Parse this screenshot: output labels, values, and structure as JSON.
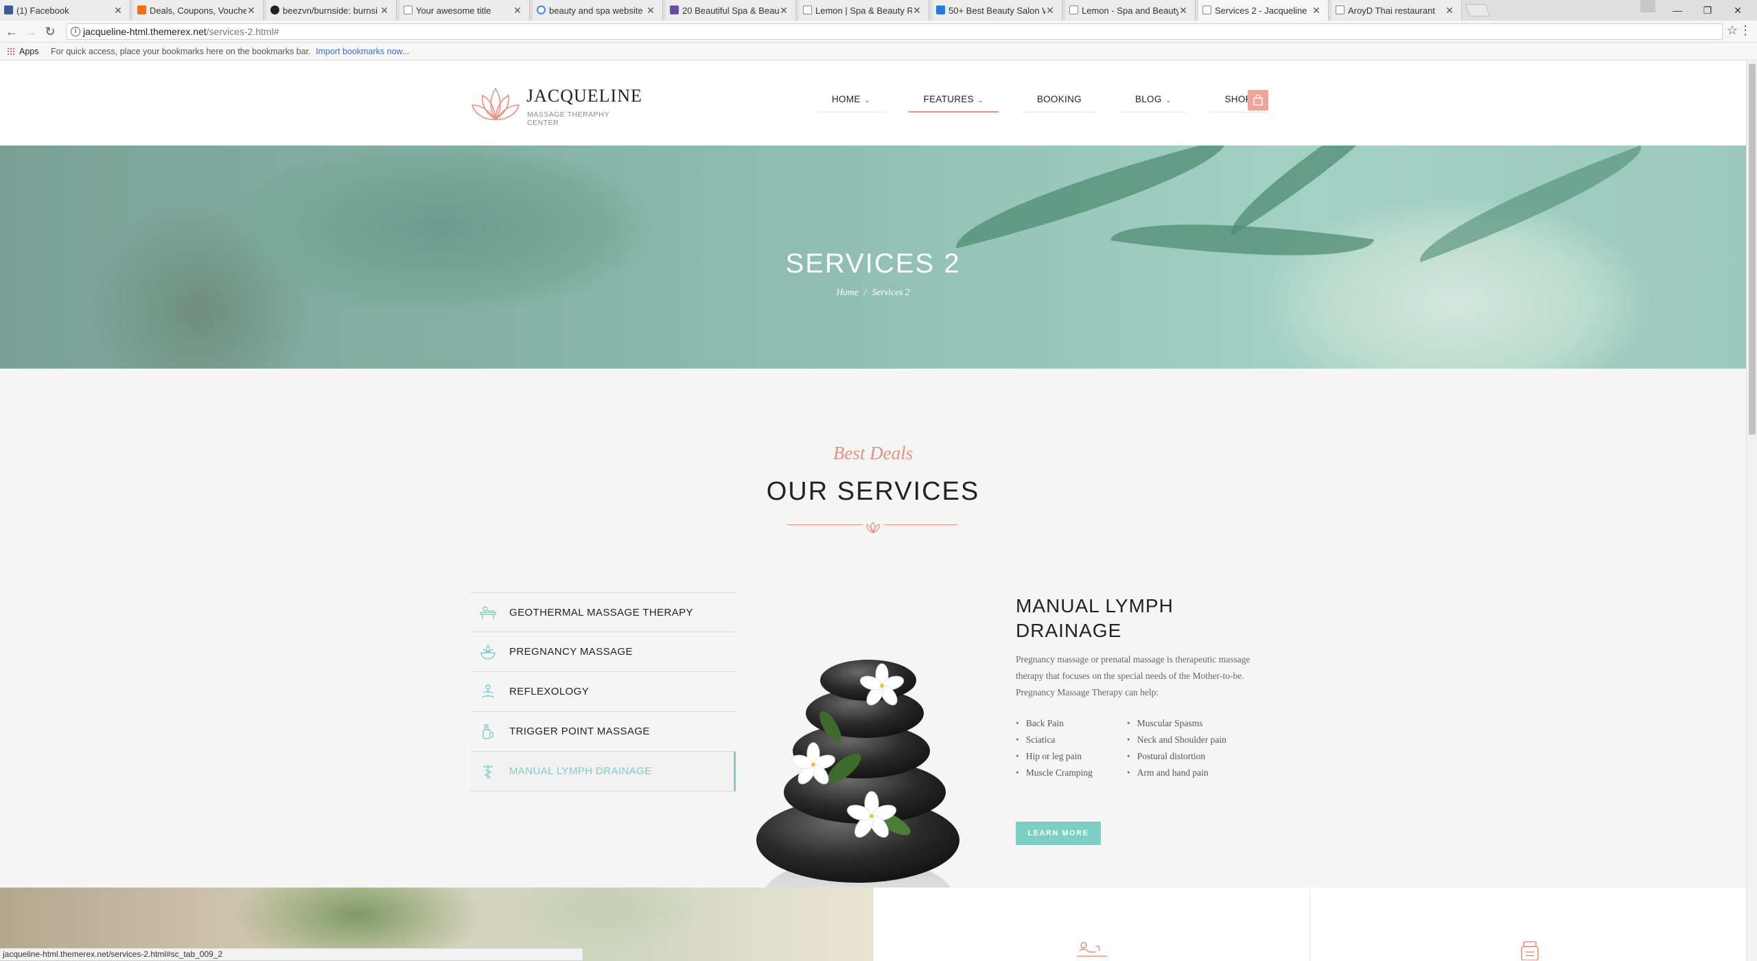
{
  "browser": {
    "tabs": [
      {
        "title": "(1) Facebook",
        "active": false
      },
      {
        "title": "Deals, Coupons, Voucher",
        "active": false
      },
      {
        "title": "beezvn/burnside: burnsi",
        "active": false
      },
      {
        "title": "Your awesome title",
        "active": false
      },
      {
        "title": "beauty and spa website",
        "active": false
      },
      {
        "title": "20 Beautiful Spa & Beau",
        "active": false
      },
      {
        "title": "Lemon | Spa & Beauty R",
        "active": false
      },
      {
        "title": "50+ Best Beauty Salon W",
        "active": false
      },
      {
        "title": "Lemon - Spa and Beauty",
        "active": false
      },
      {
        "title": "Services 2 - Jacqueline",
        "active": true
      },
      {
        "title": "AroyD Thai restaurant",
        "active": false
      }
    ],
    "url_host": "jacqueline-html.themerex.net",
    "url_path": "/services-2.html#",
    "bookmarks_apps": "Apps",
    "bookmarks_hint": "For quick access, place your bookmarks here on the bookmarks bar.",
    "bookmarks_import": "Import bookmarks now...",
    "status_url": "jacqueline-html.themerex.net/services-2.html#sc_tab_009_2"
  },
  "site": {
    "logo_name": "JACQUELINE",
    "logo_tagline": "MASSAGE THERAPHY CENTER",
    "nav": [
      {
        "label": "HOME",
        "dropdown": true,
        "active": false
      },
      {
        "label": "FEATURES",
        "dropdown": true,
        "active": true
      },
      {
        "label": "BOOKING",
        "dropdown": false,
        "active": false
      },
      {
        "label": "BLOG",
        "dropdown": true,
        "active": false
      },
      {
        "label": "SHOP",
        "dropdown": false,
        "active": false
      }
    ],
    "accent": "#e8907f",
    "teal": "#7bcfc4"
  },
  "hero": {
    "title": "SERVICES 2",
    "crumb_home": "Home",
    "crumb_sep": "/",
    "crumb_current": "Services 2"
  },
  "services": {
    "script_heading": "Best Deals",
    "title": "OUR SERVICES",
    "tabs": [
      {
        "label": "GEOTHERMAL MASSAGE THERAPY",
        "icon": "massage-table-icon",
        "active": false
      },
      {
        "label": "PREGNANCY MASSAGE",
        "icon": "lotus-bowl-icon",
        "active": false
      },
      {
        "label": "REFLEXOLOGY",
        "icon": "meditation-icon",
        "active": false
      },
      {
        "label": "TRIGGER POINT MASSAGE",
        "icon": "oil-bottle-icon",
        "active": false
      },
      {
        "label": "MANUAL LYMPH DRAINAGE",
        "icon": "caduceus-icon",
        "active": true
      }
    ],
    "detail": {
      "title": "MANUAL LYMPH DRAINAGE",
      "description": "Pregnancy massage or prenatal massage is therapeutic massage therapy that focuses on the special needs of the Mother-to-be. Pregnancy Massage Therapy can help:",
      "list_left": [
        "Back Pain",
        "Sciatica",
        "Hip or leg pain",
        "Muscle Cramping"
      ],
      "list_right": [
        "Muscular Spasms",
        "Neck and Shoulder pain",
        "Postural distortion",
        "Arm and hand pain"
      ],
      "button": "LEARN MORE"
    }
  }
}
